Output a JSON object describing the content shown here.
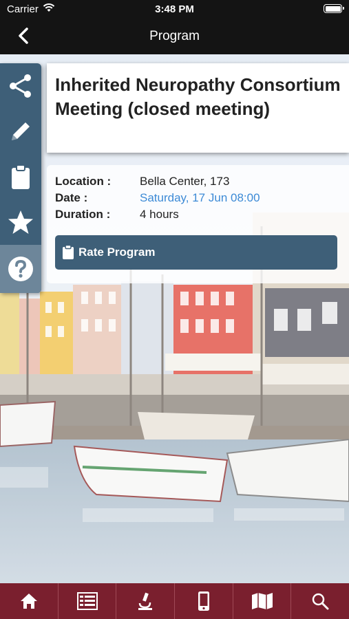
{
  "status_bar": {
    "carrier": "Carrier",
    "time": "3:48 PM"
  },
  "nav": {
    "title": "Program",
    "back_icon": "chevron-left-icon"
  },
  "sidebar": {
    "items": [
      {
        "name": "share",
        "icon": "share-icon"
      },
      {
        "name": "edit",
        "icon": "pencil-icon"
      },
      {
        "name": "clipboard",
        "icon": "clipboard-icon"
      },
      {
        "name": "favorite",
        "icon": "star-icon"
      },
      {
        "name": "help",
        "icon": "question-icon"
      }
    ]
  },
  "program": {
    "title": "Inherited Neuropathy Consortium Meeting (closed meeting)",
    "location_label": "Location :",
    "location_value": "Bella Center, 173",
    "date_label": "Date :",
    "date_value": "Saturday, 17 Jun 08:00",
    "duration_label": "Duration :",
    "duration_value": "4 hours",
    "rate_button": "Rate Program"
  },
  "tabbar": {
    "items": [
      {
        "name": "home",
        "icon": "home-icon"
      },
      {
        "name": "program",
        "icon": "list-icon"
      },
      {
        "name": "science",
        "icon": "microscope-icon"
      },
      {
        "name": "mobile",
        "icon": "phone-icon"
      },
      {
        "name": "map",
        "icon": "map-icon"
      },
      {
        "name": "search",
        "icon": "search-icon"
      }
    ]
  },
  "colors": {
    "nav_bg": "#141414",
    "sidebar_bg": "#3e5f78",
    "tabbar_bg": "#7a1f2e",
    "link": "#3c8ad6"
  }
}
